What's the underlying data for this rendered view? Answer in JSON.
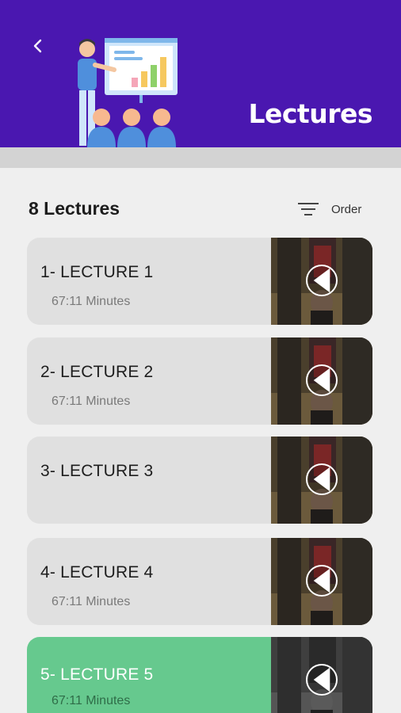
{
  "header": {
    "title": "Lectures",
    "back_icon": "chevron-left-icon",
    "illustration": "presentation-illustration",
    "color": "#4a17b0"
  },
  "summary": {
    "count_label": "8 Lectures",
    "order_label": "Order",
    "order_icon": "filter-lines-icon"
  },
  "lectures": [
    {
      "title": "1- LECTURE 1",
      "duration": "67:11 Minutes",
      "active": false
    },
    {
      "title": "2- LECTURE 2",
      "duration": "67:11 Minutes",
      "active": false
    },
    {
      "title": "3- LECTURE 3",
      "duration": "",
      "active": false
    },
    {
      "title": "4- LECTURE 4",
      "duration": "67:11 Minutes",
      "active": false
    },
    {
      "title": "5- LECTURE 5",
      "duration": "67:11 Minutes",
      "active": true
    }
  ],
  "colors": {
    "card": "#e0e0e0",
    "active_card": "#66c98e",
    "background": "#efefef"
  }
}
